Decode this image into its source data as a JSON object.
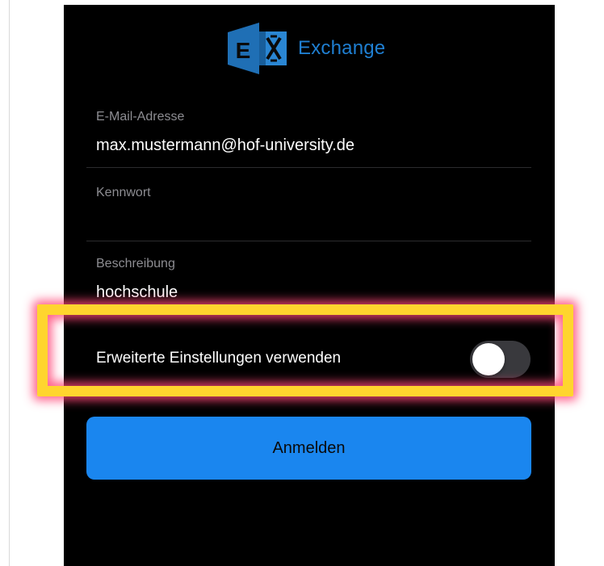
{
  "header": {
    "logo_icon": "exchange-logo-icon",
    "logo_text": "Exchange",
    "brand_color": "#1f7fd2"
  },
  "form": {
    "email": {
      "label": "E-Mail-Adresse",
      "value": "max.mustermann@hof-university.de"
    },
    "password": {
      "label": "Kennwort",
      "value": ""
    },
    "description": {
      "label": "Beschreibung",
      "value": "hochschule"
    }
  },
  "advanced": {
    "label": "Erweiterte Einstellungen verwenden",
    "enabled": false
  },
  "login_button": {
    "label": "Anmelden",
    "color": "#1a86ef"
  },
  "annotation": {
    "highlight_color": "#ffd52e",
    "glow_color": "#ff4678"
  }
}
